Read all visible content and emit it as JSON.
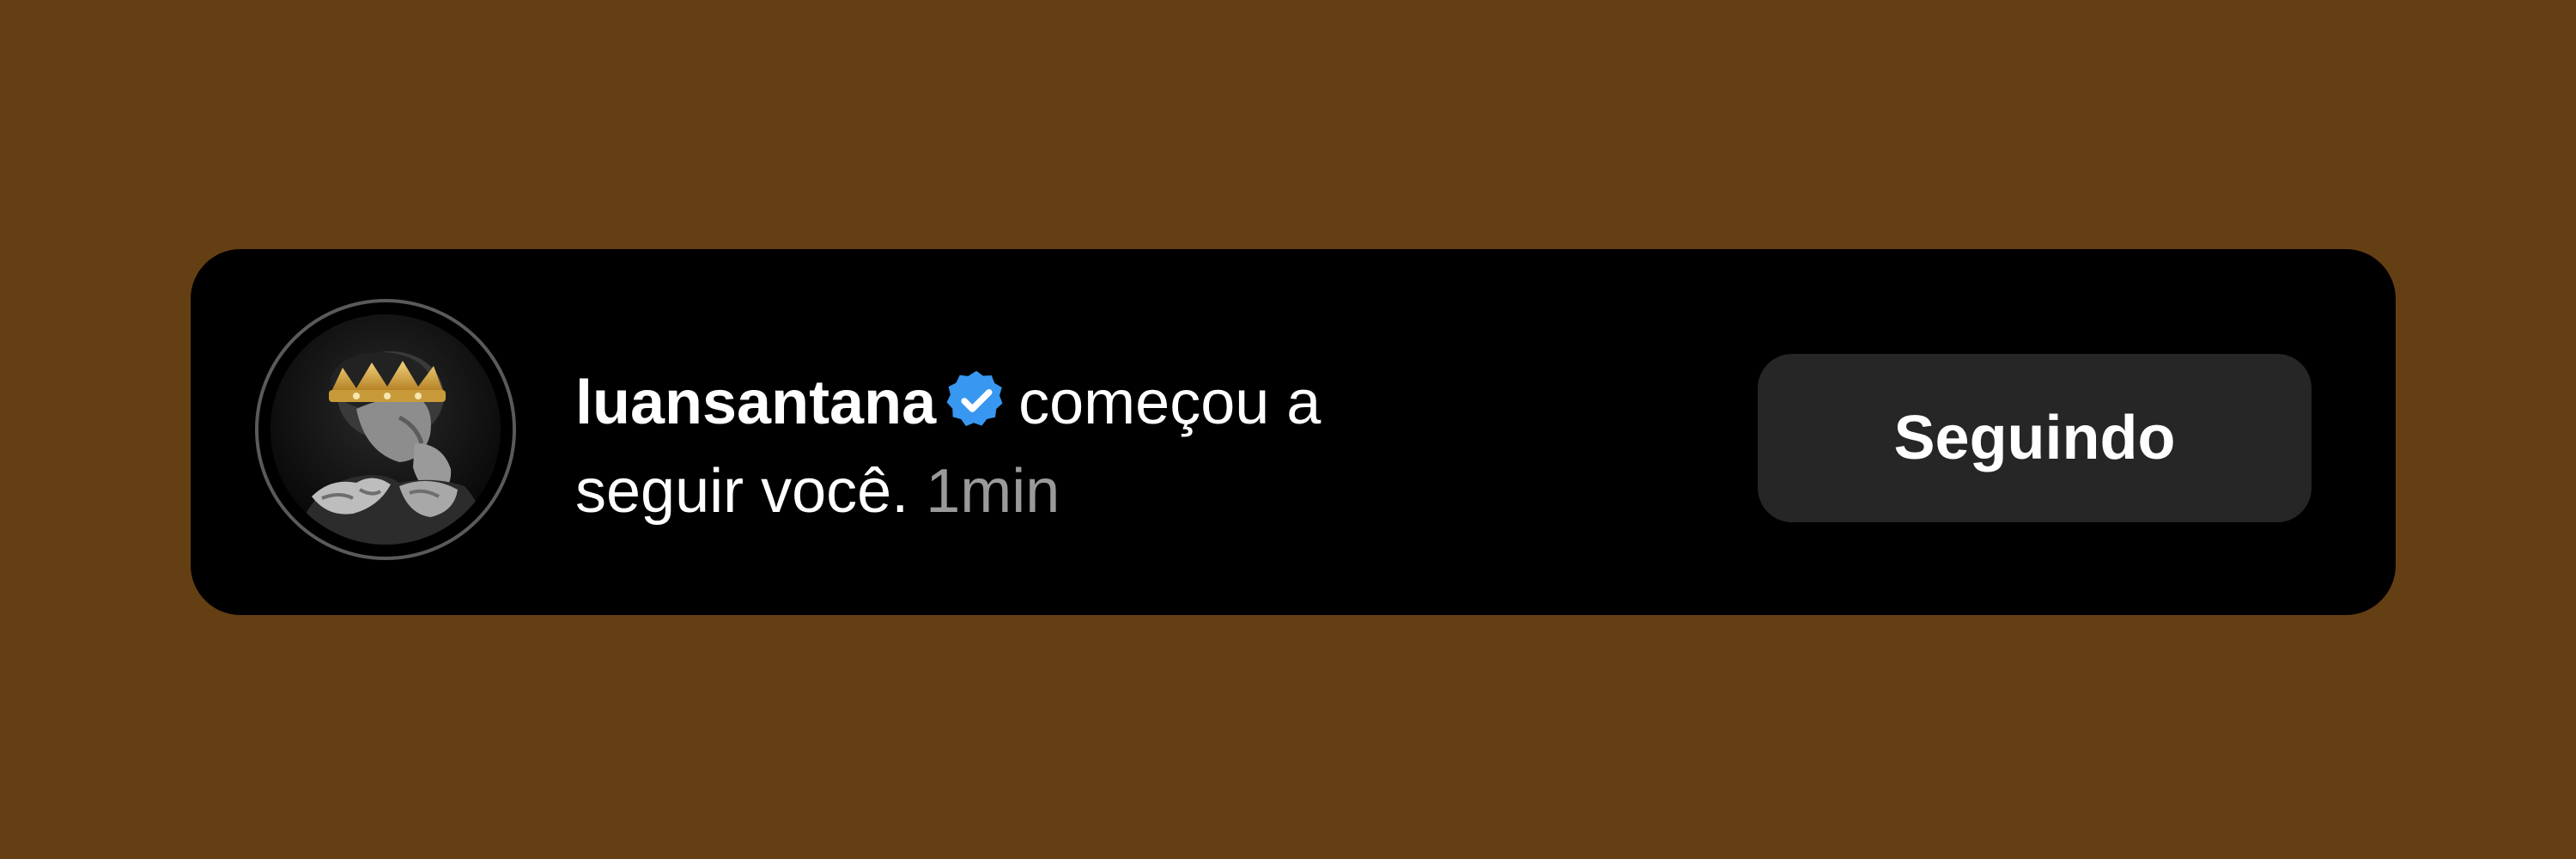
{
  "notification": {
    "username": "luansantana",
    "verified_icon": "verified-badge-icon",
    "action_text_line1": "começou a",
    "action_text_line2": "seguir você.",
    "time_ago": "1min",
    "button_label": "Seguindo"
  },
  "colors": {
    "background": "#653f14",
    "card": "#000000",
    "button": "#262626",
    "verified_blue": "#3897f0",
    "muted_text": "#9a9a9a",
    "text": "#ffffff"
  },
  "avatar": {
    "icon": "profile-avatar-icon"
  }
}
